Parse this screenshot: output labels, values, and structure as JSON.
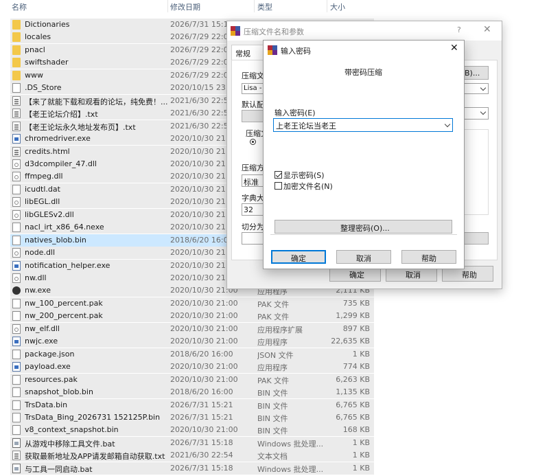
{
  "columns": {
    "name": "名称",
    "date": "修改日期",
    "type": "类型",
    "size": "大小"
  },
  "files": [
    {
      "name": "Dictionaries",
      "date": "2026/7/31 15:1",
      "type": "",
      "size": "",
      "icon": "folder-icon"
    },
    {
      "name": "locales",
      "date": "2026/7/29 22:0",
      "type": "",
      "size": "",
      "icon": "folder-icon"
    },
    {
      "name": "pnacl",
      "date": "2026/7/29 22:0",
      "type": "",
      "size": "",
      "icon": "folder-icon"
    },
    {
      "name": "swiftshader",
      "date": "2026/7/29 22:0",
      "type": "",
      "size": "",
      "icon": "folder-icon"
    },
    {
      "name": "www",
      "date": "2026/7/29 22:0",
      "type": "",
      "size": "",
      "icon": "folder-icon"
    },
    {
      "name": ".DS_Store",
      "date": "2020/10/15 23:",
      "type": "",
      "size": "",
      "icon": "file-icon"
    },
    {
      "name": "【来了就能下载和观看的论坛，纯免费！...",
      "date": "2021/6/30 22:5",
      "type": "",
      "size": "",
      "icon": "html-file-icon"
    },
    {
      "name": "【老王论坛介绍】.txt",
      "date": "2021/6/30 22:5",
      "type": "",
      "size": "",
      "icon": "text-file-icon"
    },
    {
      "name": "【老王论坛永久地址发布页】.txt",
      "date": "2021/6/30 22:5",
      "type": "",
      "size": "",
      "icon": "text-file-icon"
    },
    {
      "name": "chromedriver.exe",
      "date": "2020/10/30 21:",
      "type": "",
      "size": "",
      "icon": "exe-icon"
    },
    {
      "name": "credits.html",
      "date": "2020/10/30 21:",
      "type": "",
      "size": "",
      "icon": "html-file-icon"
    },
    {
      "name": "d3dcompiler_47.dll",
      "date": "2020/10/30 21:",
      "type": "",
      "size": "",
      "icon": "dll-icon"
    },
    {
      "name": "ffmpeg.dll",
      "date": "2020/10/30 21:",
      "type": "",
      "size": "",
      "icon": "dll-icon"
    },
    {
      "name": "icudtl.dat",
      "date": "2020/10/30 21:",
      "type": "",
      "size": "",
      "icon": "file-icon"
    },
    {
      "name": "libEGL.dll",
      "date": "2020/10/30 21:",
      "type": "",
      "size": "",
      "icon": "dll-icon"
    },
    {
      "name": "libGLESv2.dll",
      "date": "2020/10/30 21:",
      "type": "",
      "size": "",
      "icon": "dll-icon"
    },
    {
      "name": "nacl_irt_x86_64.nexe",
      "date": "2020/10/30 21:",
      "type": "",
      "size": "",
      "icon": "file-icon"
    },
    {
      "name": "natives_blob.bin",
      "date": "2018/6/20 16:0",
      "type": "",
      "size": "",
      "icon": "file-icon",
      "selected": true
    },
    {
      "name": "node.dll",
      "date": "2020/10/30 21:",
      "type": "",
      "size": "",
      "icon": "dll-icon"
    },
    {
      "name": "notification_helper.exe",
      "date": "2020/10/30 21:",
      "type": "",
      "size": "",
      "icon": "exe-icon"
    },
    {
      "name": "nw.dll",
      "date": "2020/10/30 21:",
      "type": "",
      "size": "",
      "icon": "dll-icon"
    },
    {
      "name": "nw.exe",
      "date": "2020/10/30 21:00",
      "type": "应用程序",
      "size": "2,111 KB",
      "icon": "nw-app-icon"
    },
    {
      "name": "nw_100_percent.pak",
      "date": "2020/10/30 21:00",
      "type": "PAK 文件",
      "size": "735 KB",
      "icon": "file-icon"
    },
    {
      "name": "nw_200_percent.pak",
      "date": "2020/10/30 21:00",
      "type": "PAK 文件",
      "size": "1,299 KB",
      "icon": "file-icon"
    },
    {
      "name": "nw_elf.dll",
      "date": "2020/10/30 21:00",
      "type": "应用程序扩展",
      "size": "897 KB",
      "icon": "dll-icon"
    },
    {
      "name": "nwjc.exe",
      "date": "2020/10/30 21:00",
      "type": "应用程序",
      "size": "22,635 KB",
      "icon": "exe-icon"
    },
    {
      "name": "package.json",
      "date": "2018/6/20 16:00",
      "type": "JSON 文件",
      "size": "1 KB",
      "icon": "file-icon"
    },
    {
      "name": "payload.exe",
      "date": "2020/10/30 21:00",
      "type": "应用程序",
      "size": "774 KB",
      "icon": "exe-icon"
    },
    {
      "name": "resources.pak",
      "date": "2020/10/30 21:00",
      "type": "PAK 文件",
      "size": "6,263 KB",
      "icon": "file-icon"
    },
    {
      "name": "snapshot_blob.bin",
      "date": "2018/6/20 16:00",
      "type": "BIN 文件",
      "size": "1,135 KB",
      "icon": "file-icon"
    },
    {
      "name": "TrsData.bin",
      "date": "2026/7/31 15:21",
      "type": "BIN 文件",
      "size": "6,765 KB",
      "icon": "file-icon"
    },
    {
      "name": "TrsData_Bing_2026731 152125P.bin",
      "date": "2026/7/31 15:21",
      "type": "BIN 文件",
      "size": "6,765 KB",
      "icon": "file-icon"
    },
    {
      "name": "v8_context_snapshot.bin",
      "date": "2020/10/30 21:00",
      "type": "BIN 文件",
      "size": "168 KB",
      "icon": "file-icon"
    },
    {
      "name": "从游戏中移除工具文件.bat",
      "date": "2026/7/31 15:18",
      "type": "Windows 批处理...",
      "size": "1 KB",
      "icon": "bat-icon"
    },
    {
      "name": "获取最新地址及APP请发邮箱自动获取.txt",
      "date": "2021/6/30 22:54",
      "type": "文本文档",
      "size": "1 KB",
      "icon": "text-file-icon"
    },
    {
      "name": "与工具一同启动.bat",
      "date": "2026/7/31 15:18",
      "type": "Windows 批处理...",
      "size": "1 KB",
      "icon": "bat-icon"
    }
  ],
  "archive_dialog": {
    "title": "压缩文件名和参数",
    "help": "?",
    "close": "✕",
    "tab_general": "常规",
    "archive_name_label": "压缩文",
    "archive_name_value": "Lisa - S",
    "browse_label": "B)...",
    "default_profile_label": "默认配",
    "format_label": "压缩文",
    "method_label": "压缩方",
    "method_value": "标准",
    "dict_label": "字典大",
    "dict_value": "32",
    "split_label": "切分为",
    "ok": "确定",
    "cancel": "取消",
    "help_btn": "帮助"
  },
  "password_dialog": {
    "title": "输入密码",
    "close": "✕",
    "heading": "带密码压缩",
    "password_label": "输入密码(E)",
    "password_value": "上老王论坛当老王",
    "show_password_label": "显示密码(S)",
    "show_password_checked": true,
    "encrypt_names_label": "加密文件名(N)",
    "encrypt_names_checked": false,
    "organize_button": "整理密码(O)...",
    "ok": "确定",
    "cancel": "取消",
    "help": "帮助"
  },
  "colors": {
    "selection": "#cce8ff",
    "row": "#ebebeb",
    "accent": "#0078d7"
  }
}
